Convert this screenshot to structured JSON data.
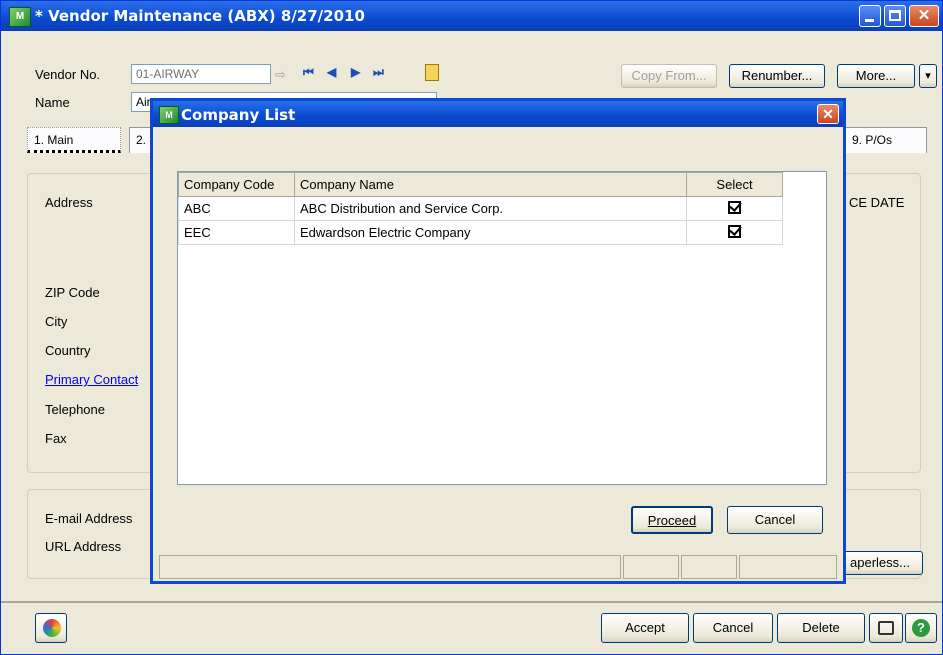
{
  "window": {
    "title": "* Vendor Maintenance (ABX) 8/27/2010",
    "app_icon": "mas-icon"
  },
  "header": {
    "vendor_no_label": "Vendor No.",
    "vendor_no_value": "01-AIRWAY",
    "name_label": "Name",
    "name_value": "Air",
    "copy_from_label": "Copy From...",
    "renumber_label": "Renumber...",
    "more_label": "More...",
    "more_arrow": "▾",
    "nav_glyphs": {
      "first": "⏮",
      "prev": "◀",
      "next": "▶",
      "last": "⏭"
    }
  },
  "tabs": [
    {
      "label": "1. Main"
    },
    {
      "label": "2."
    },
    {
      "label": "9. P/Os"
    }
  ],
  "main": {
    "address_label": "Address",
    "zip_label": "ZIP Code",
    "city_label": "City",
    "country_label": "Country",
    "primary_contact_label": "Primary Contact",
    "telephone_label": "Telephone",
    "fax_label": "Fax",
    "email_label": "E-mail Address",
    "url_label": "URL Address",
    "side_label": "CE DATE",
    "paperless_label": "aperless..."
  },
  "dialog": {
    "title": "Company List",
    "close_glyph": "✕",
    "columns": [
      "Company Code",
      "Company Name",
      "Select"
    ],
    "rows": [
      {
        "code": "ABC",
        "name": "ABC Distribution and Service Corp.",
        "selected": true
      },
      {
        "code": "EEC",
        "name": "Edwardson Electric Company",
        "selected": true
      }
    ],
    "proceed_label": "Proceed",
    "cancel_label": "Cancel"
  },
  "footer": {
    "accept_label": "Accept",
    "cancel_label": "Cancel",
    "delete_label": "Delete"
  },
  "colors": {
    "titlebar": "#0a4ad0",
    "window_bg": "#ece9d8",
    "link": "#0000ee"
  }
}
